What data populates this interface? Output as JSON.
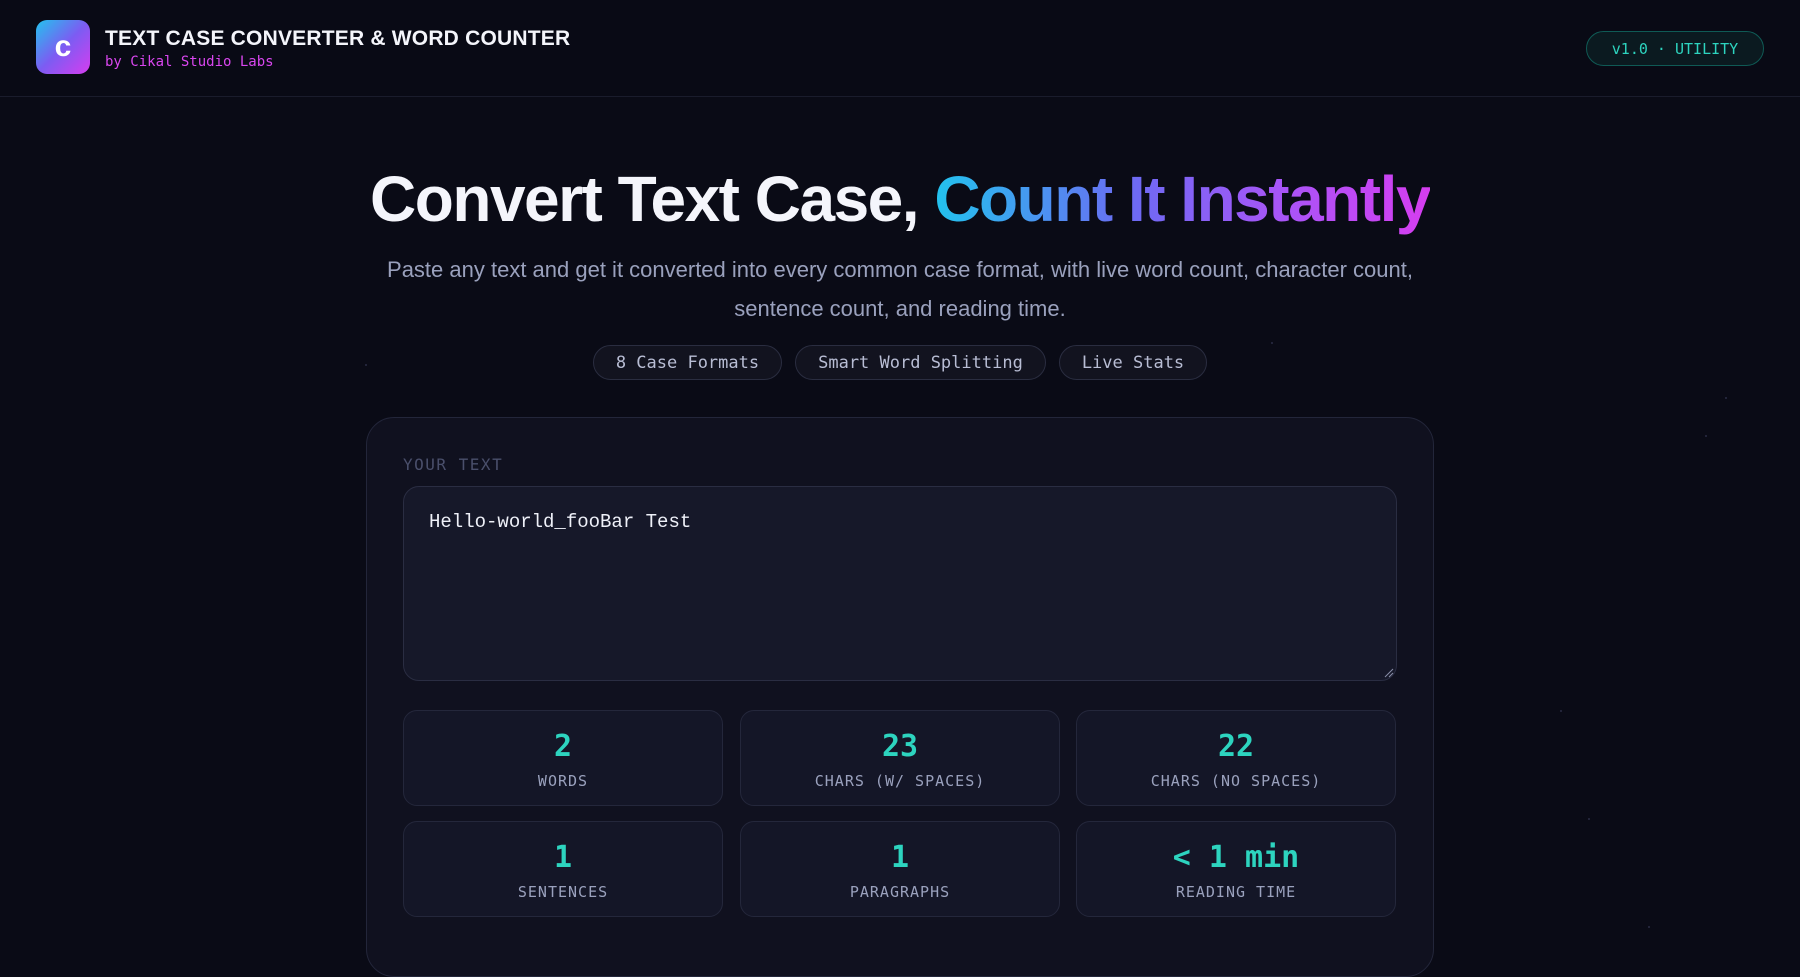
{
  "header": {
    "logo_letter": "c",
    "title": "TEXT CASE CONVERTER & WORD COUNTER",
    "subtitle": "by Cikal Studio Labs",
    "version_badge": "v1.0 · UTILITY"
  },
  "hero": {
    "title_plain": "Convert Text Case,",
    "title_gradient": "Count It Instantly",
    "description": "Paste any text and get it converted into every common case format, with live word count, character count, sentence count, and reading time.",
    "chips": [
      "8 Case Formats",
      "Smart Word Splitting",
      "Live Stats"
    ]
  },
  "editor": {
    "label": "YOUR TEXT",
    "value": "Hello-world_fooBar Test"
  },
  "stats": [
    {
      "value": "2",
      "label": "WORDS"
    },
    {
      "value": "23",
      "label": "CHARS (W/ SPACES)"
    },
    {
      "value": "22",
      "label": "CHARS (NO SPACES)"
    },
    {
      "value": "1",
      "label": "SENTENCES"
    },
    {
      "value": "1",
      "label": "PARAGRAPHS"
    },
    {
      "value": "< 1 min",
      "label": "READING TIME"
    }
  ],
  "colors": {
    "background": "#0a0b16",
    "accent_teal": "#2dd4bf",
    "accent_magenta": "#d946ef",
    "gradient_start": "#22c3ee",
    "gradient_end": "#d63df0"
  }
}
